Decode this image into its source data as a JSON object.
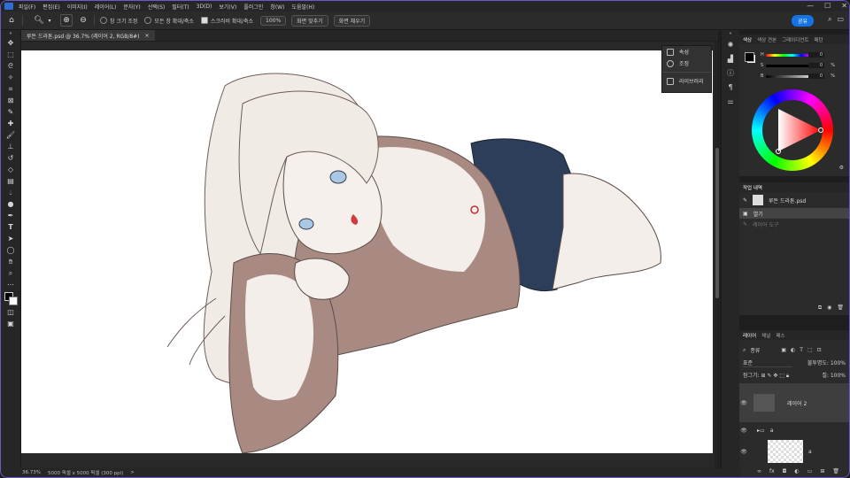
{
  "menu": [
    "파일(F)",
    "편집(E)",
    "이미지(I)",
    "레이어(L)",
    "문자(Y)",
    "선택(S)",
    "필터(T)",
    "3D(D)",
    "보기(V)",
    "플러그인",
    "창(W)",
    "도움말(H)"
  ],
  "window_controls": [
    "—",
    "☐",
    "✕"
  ],
  "options": {
    "resize_windows": "창 크기 조정",
    "zoom_all": "모든 창 확대/축소",
    "scrubby": "스크러비 확대/축소",
    "zoom_level": "100%",
    "fit_screen": "화면 맞추기",
    "fill_screen": "화면 채우기"
  },
  "share_label": "공유",
  "document": {
    "tab_label": "루돈 드라톤.psd @ 36.7% (레이어 2, RGB/8#)",
    "close": "×"
  },
  "status": {
    "zoom": "36.73%",
    "dims": "5000 픽셀 x 5000 픽셀 (300 ppi)",
    "arrow": ">"
  },
  "flyout": {
    "items": [
      "속성",
      "조정",
      "라이브러리"
    ]
  },
  "color_panel": {
    "tabs": [
      "색상",
      "색상 견본",
      "그레이디언트",
      "패턴"
    ],
    "channels": [
      {
        "label": "H",
        "value": "0"
      },
      {
        "label": "S",
        "value": "0",
        "unit": "%"
      },
      {
        "label": "B",
        "value": "0",
        "unit": "%"
      }
    ]
  },
  "history_panel": {
    "title": "작업 내역",
    "file": "루돈 드라톤.psd",
    "states": [
      "열기",
      "레이어 도구"
    ]
  },
  "layers_panel": {
    "tabs": [
      "레이어",
      "채널",
      "패스"
    ],
    "filter": "종류",
    "blend_mode": "표준",
    "opacity_label": "불투명도:",
    "opacity_value": "100%",
    "lock_label": "잠그기:",
    "fill_label": "칠:",
    "fill_value": "100%",
    "layers": [
      {
        "name": "레이어 2",
        "selected": true
      },
      {
        "name": "a",
        "type": "group"
      },
      {
        "name": "a",
        "type": "pixel"
      }
    ]
  },
  "colors": {
    "accent": "#1473e6",
    "skirt": "#2c3e5a",
    "shadow": "#a88a82",
    "skin": "#f3eeea",
    "mouth": "#d23b3b",
    "eyes": "#a9c8e6"
  }
}
